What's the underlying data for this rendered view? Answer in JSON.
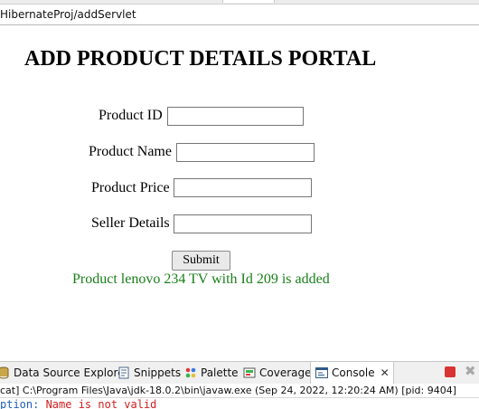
{
  "browser": {
    "url": "HibernateProj/addServlet"
  },
  "page": {
    "title": "ADD PRODUCT DETAILS PORTAL",
    "fields": [
      {
        "label": "Product ID",
        "value": ""
      },
      {
        "label": "Product Name",
        "value": ""
      },
      {
        "label": "Product Price",
        "value": ""
      },
      {
        "label": "Seller Details",
        "value": ""
      }
    ],
    "submit_label": "Submit",
    "message": "Product lenovo 234 TV with Id 209 is added",
    "message_color": "#1a7f1a"
  },
  "views": {
    "tabs": [
      {
        "label": "Data Source Explorer",
        "icon": "database-icon"
      },
      {
        "label": "Snippets",
        "icon": "snippets-icon"
      },
      {
        "label": "Palette",
        "icon": "palette-icon"
      },
      {
        "label": "Coverage",
        "icon": "coverage-icon"
      },
      {
        "label": "Console",
        "icon": "console-icon",
        "active": true
      }
    ],
    "close_glyph": "✕",
    "stop_icon": "terminate-icon",
    "remove_icon": "remove-launch-icon"
  },
  "console": {
    "path": "cat] C:\\Program Files\\Java\\jdk-18.0.2\\bin\\javaw.exe  (Sep 24, 2022, 12:20:24 AM) [pid: 9404]",
    "line_prefix": "ption: ",
    "line_error": "Name is not valid"
  },
  "colors": {
    "error": "#d11f1f",
    "stop": "#d93434"
  }
}
